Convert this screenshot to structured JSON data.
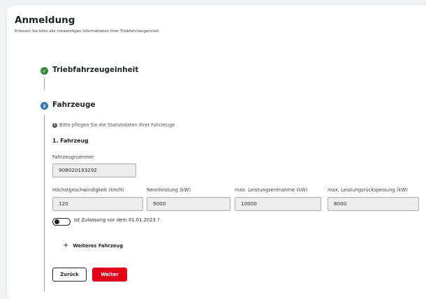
{
  "header": {
    "title": "Anmeldung",
    "subtitle": "Erfassen Sie bitte alle notwendigen Informationen Ihrer Triebfahrzeugeinheit"
  },
  "steps": [
    {
      "number": "✓",
      "title": "Triebfahrzeugeinheit",
      "status": "done"
    },
    {
      "number": "2",
      "title": "Fahrzeuge",
      "status": "active"
    }
  ],
  "info": {
    "icon": "info-icon",
    "text": "Bitte pflegen Sie die Stammdaten Ihrer Fahrzeuge"
  },
  "vehicle": {
    "heading": "1. Fahrzeug",
    "number_label": "Fahrzeugnummer",
    "number_value": "908020193292",
    "fields": [
      {
        "label": "Höchstgeschwindigkeit (km/h)",
        "value": "120"
      },
      {
        "label": "Nennleistung (kW)",
        "value": "9000"
      },
      {
        "label": "max. Leistungsentnahme (kW)",
        "value": "10000"
      },
      {
        "label": "max. Leistungsrückspeisung (kW)",
        "value": "8000"
      }
    ]
  },
  "toggle": {
    "label": "Ist Zulassung vor dem 01.01.2023 ?",
    "checked": false
  },
  "add_vehicle_label": "Weiteres Fahrzeug",
  "buttons": {
    "back": "Zurück",
    "next": "Weiter"
  },
  "colors": {
    "primary_red": "#e3001b",
    "step_done": "#3b8b3c",
    "step_active": "#2f77b6"
  }
}
